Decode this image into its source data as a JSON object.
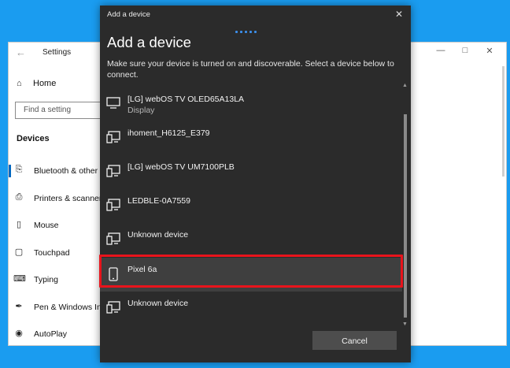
{
  "settings": {
    "title": "Settings",
    "home_label": "Home",
    "search_placeholder": "Find a setting",
    "section": "Devices",
    "nav": [
      {
        "label": "Bluetooth & other devices",
        "icon": "bluetooth-icon",
        "active": true
      },
      {
        "label": "Printers & scanners",
        "icon": "printer-icon"
      },
      {
        "label": "Mouse",
        "icon": "mouse-icon"
      },
      {
        "label": "Touchpad",
        "icon": "touchpad-icon"
      },
      {
        "label": "Typing",
        "icon": "keyboard-icon"
      },
      {
        "label": "Pen & Windows Ink",
        "icon": "pen-icon"
      },
      {
        "label": "AutoPlay",
        "icon": "autoplay-icon"
      }
    ]
  },
  "dialog": {
    "titlebar": "Add a device",
    "heading": "Add a device",
    "description": "Make sure your device is turned on and discoverable. Select a device below to connect.",
    "devices": [
      {
        "name": "[LG] webOS TV OLED65A13LA",
        "subtitle": "Display",
        "icon": "monitor-icon"
      },
      {
        "name": "ihoment_H6125_E379",
        "icon": "generic-device-icon"
      },
      {
        "name": "[LG] webOS TV UM7100PLB",
        "icon": "generic-device-icon"
      },
      {
        "name": "LEDBLE-0A7559",
        "icon": "generic-device-icon"
      },
      {
        "name": "Unknown device",
        "icon": "generic-device-icon"
      },
      {
        "name": "Pixel 6a",
        "icon": "phone-icon",
        "selected": true
      },
      {
        "name": "Unknown device",
        "icon": "generic-device-icon"
      }
    ],
    "cancel_label": "Cancel"
  },
  "colors": {
    "desktop": "#1a9cf0",
    "dialog_bg": "#2b2b2b",
    "highlight": "#e8141c",
    "accent": "#0067c0"
  }
}
